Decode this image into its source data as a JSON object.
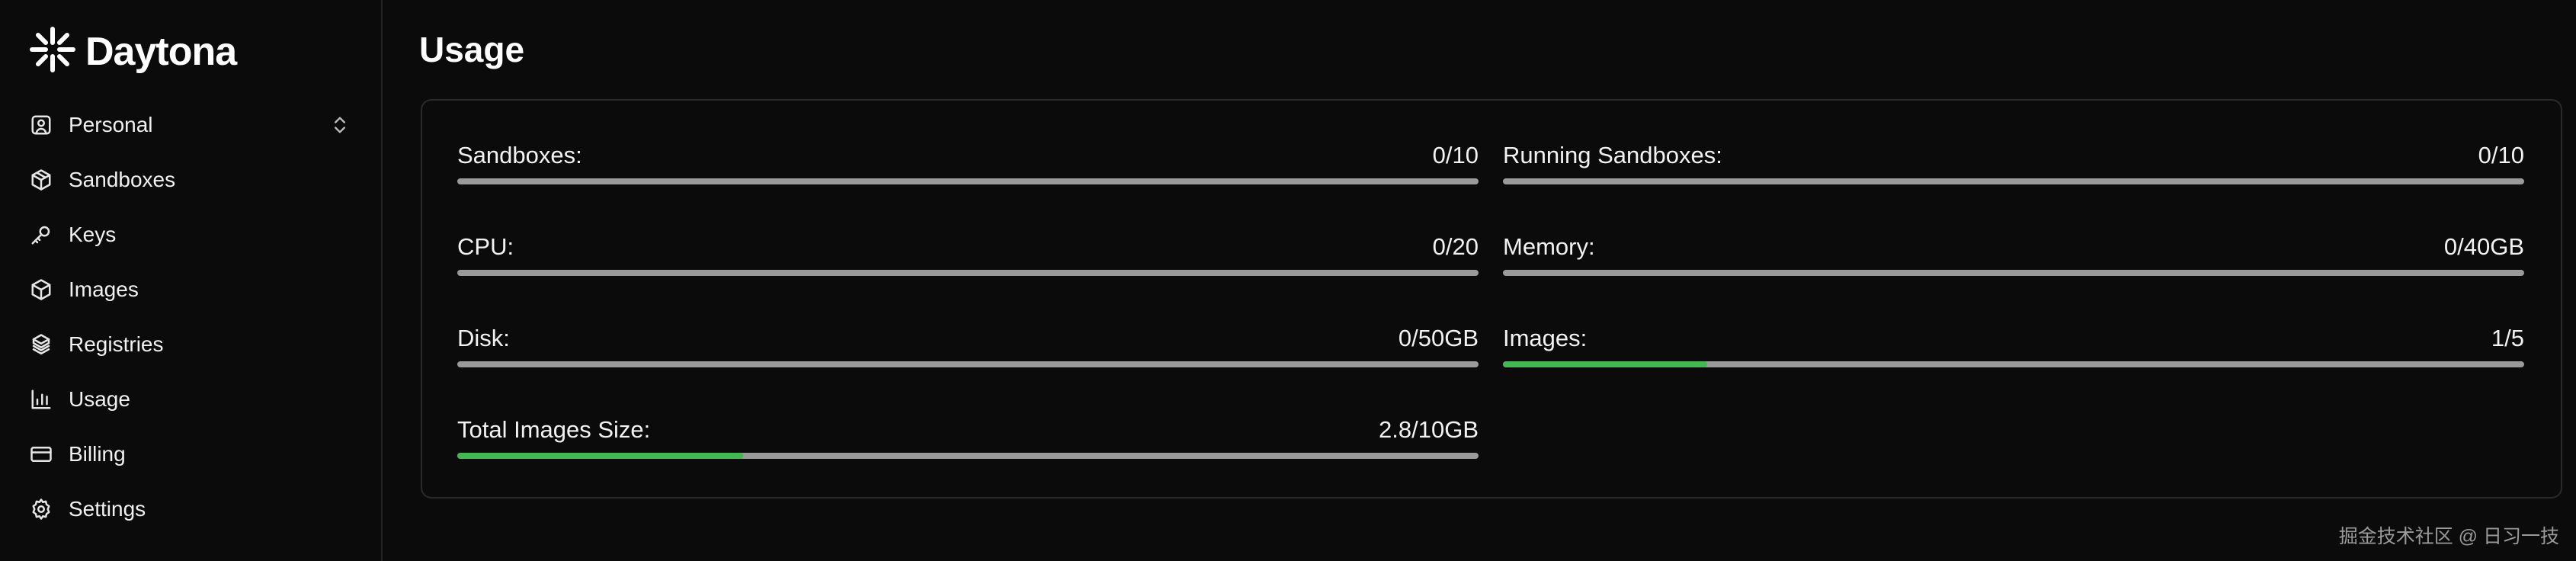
{
  "app": {
    "name": "Daytona"
  },
  "sidebar": {
    "items": [
      {
        "label": "Personal",
        "icon": "user-square-icon"
      },
      {
        "label": "Sandboxes",
        "icon": "box-icon"
      },
      {
        "label": "Keys",
        "icon": "key-icon"
      },
      {
        "label": "Images",
        "icon": "package-icon"
      },
      {
        "label": "Registries",
        "icon": "boxes-icon"
      },
      {
        "label": "Usage",
        "icon": "bar-chart-icon"
      },
      {
        "label": "Billing",
        "icon": "credit-card-icon"
      },
      {
        "label": "Settings",
        "icon": "gear-icon"
      }
    ]
  },
  "page": {
    "title": "Usage"
  },
  "usage": {
    "metrics": [
      {
        "label": "Sandboxes:",
        "value": "0/10",
        "fraction": 0
      },
      {
        "label": "Running Sandboxes:",
        "value": "0/10",
        "fraction": 0
      },
      {
        "label": "CPU:",
        "value": "0/20",
        "fraction": 0
      },
      {
        "label": "Memory:",
        "value": "0/40GB",
        "fraction": 0
      },
      {
        "label": "Disk:",
        "value": "0/50GB",
        "fraction": 0
      },
      {
        "label": "Images:",
        "value": "1/5",
        "fraction": 0.2
      },
      {
        "label": "Total Images Size:",
        "value": "2.8/10GB",
        "fraction": 0.28
      }
    ]
  },
  "colors": {
    "accent": "#3fb950",
    "track": "#9a9a9a",
    "background": "#0b0b0b"
  },
  "watermark": "掘金技术社区 @ 日习一技"
}
